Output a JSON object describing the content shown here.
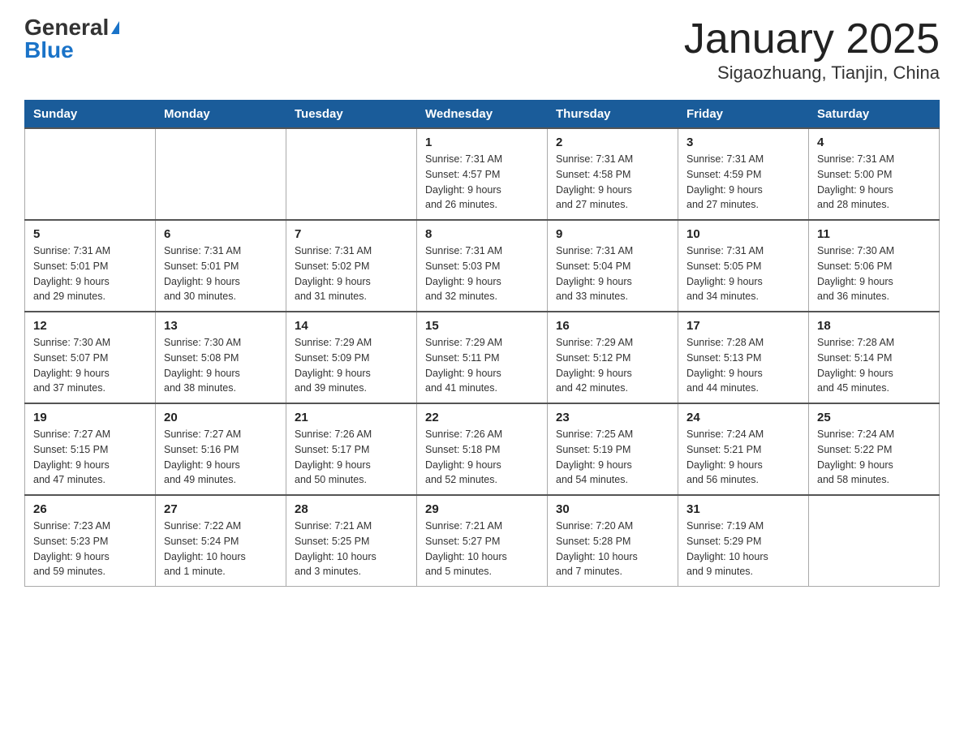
{
  "header": {
    "logo_general": "General",
    "logo_blue": "Blue",
    "month": "January 2025",
    "location": "Sigaozhuang, Tianjin, China"
  },
  "days_of_week": [
    "Sunday",
    "Monday",
    "Tuesday",
    "Wednesday",
    "Thursday",
    "Friday",
    "Saturday"
  ],
  "weeks": [
    [
      {
        "day": "",
        "info": ""
      },
      {
        "day": "",
        "info": ""
      },
      {
        "day": "",
        "info": ""
      },
      {
        "day": "1",
        "info": "Sunrise: 7:31 AM\nSunset: 4:57 PM\nDaylight: 9 hours\nand 26 minutes."
      },
      {
        "day": "2",
        "info": "Sunrise: 7:31 AM\nSunset: 4:58 PM\nDaylight: 9 hours\nand 27 minutes."
      },
      {
        "day": "3",
        "info": "Sunrise: 7:31 AM\nSunset: 4:59 PM\nDaylight: 9 hours\nand 27 minutes."
      },
      {
        "day": "4",
        "info": "Sunrise: 7:31 AM\nSunset: 5:00 PM\nDaylight: 9 hours\nand 28 minutes."
      }
    ],
    [
      {
        "day": "5",
        "info": "Sunrise: 7:31 AM\nSunset: 5:01 PM\nDaylight: 9 hours\nand 29 minutes."
      },
      {
        "day": "6",
        "info": "Sunrise: 7:31 AM\nSunset: 5:01 PM\nDaylight: 9 hours\nand 30 minutes."
      },
      {
        "day": "7",
        "info": "Sunrise: 7:31 AM\nSunset: 5:02 PM\nDaylight: 9 hours\nand 31 minutes."
      },
      {
        "day": "8",
        "info": "Sunrise: 7:31 AM\nSunset: 5:03 PM\nDaylight: 9 hours\nand 32 minutes."
      },
      {
        "day": "9",
        "info": "Sunrise: 7:31 AM\nSunset: 5:04 PM\nDaylight: 9 hours\nand 33 minutes."
      },
      {
        "day": "10",
        "info": "Sunrise: 7:31 AM\nSunset: 5:05 PM\nDaylight: 9 hours\nand 34 minutes."
      },
      {
        "day": "11",
        "info": "Sunrise: 7:30 AM\nSunset: 5:06 PM\nDaylight: 9 hours\nand 36 minutes."
      }
    ],
    [
      {
        "day": "12",
        "info": "Sunrise: 7:30 AM\nSunset: 5:07 PM\nDaylight: 9 hours\nand 37 minutes."
      },
      {
        "day": "13",
        "info": "Sunrise: 7:30 AM\nSunset: 5:08 PM\nDaylight: 9 hours\nand 38 minutes."
      },
      {
        "day": "14",
        "info": "Sunrise: 7:29 AM\nSunset: 5:09 PM\nDaylight: 9 hours\nand 39 minutes."
      },
      {
        "day": "15",
        "info": "Sunrise: 7:29 AM\nSunset: 5:11 PM\nDaylight: 9 hours\nand 41 minutes."
      },
      {
        "day": "16",
        "info": "Sunrise: 7:29 AM\nSunset: 5:12 PM\nDaylight: 9 hours\nand 42 minutes."
      },
      {
        "day": "17",
        "info": "Sunrise: 7:28 AM\nSunset: 5:13 PM\nDaylight: 9 hours\nand 44 minutes."
      },
      {
        "day": "18",
        "info": "Sunrise: 7:28 AM\nSunset: 5:14 PM\nDaylight: 9 hours\nand 45 minutes."
      }
    ],
    [
      {
        "day": "19",
        "info": "Sunrise: 7:27 AM\nSunset: 5:15 PM\nDaylight: 9 hours\nand 47 minutes."
      },
      {
        "day": "20",
        "info": "Sunrise: 7:27 AM\nSunset: 5:16 PM\nDaylight: 9 hours\nand 49 minutes."
      },
      {
        "day": "21",
        "info": "Sunrise: 7:26 AM\nSunset: 5:17 PM\nDaylight: 9 hours\nand 50 minutes."
      },
      {
        "day": "22",
        "info": "Sunrise: 7:26 AM\nSunset: 5:18 PM\nDaylight: 9 hours\nand 52 minutes."
      },
      {
        "day": "23",
        "info": "Sunrise: 7:25 AM\nSunset: 5:19 PM\nDaylight: 9 hours\nand 54 minutes."
      },
      {
        "day": "24",
        "info": "Sunrise: 7:24 AM\nSunset: 5:21 PM\nDaylight: 9 hours\nand 56 minutes."
      },
      {
        "day": "25",
        "info": "Sunrise: 7:24 AM\nSunset: 5:22 PM\nDaylight: 9 hours\nand 58 minutes."
      }
    ],
    [
      {
        "day": "26",
        "info": "Sunrise: 7:23 AM\nSunset: 5:23 PM\nDaylight: 9 hours\nand 59 minutes."
      },
      {
        "day": "27",
        "info": "Sunrise: 7:22 AM\nSunset: 5:24 PM\nDaylight: 10 hours\nand 1 minute."
      },
      {
        "day": "28",
        "info": "Sunrise: 7:21 AM\nSunset: 5:25 PM\nDaylight: 10 hours\nand 3 minutes."
      },
      {
        "day": "29",
        "info": "Sunrise: 7:21 AM\nSunset: 5:27 PM\nDaylight: 10 hours\nand 5 minutes."
      },
      {
        "day": "30",
        "info": "Sunrise: 7:20 AM\nSunset: 5:28 PM\nDaylight: 10 hours\nand 7 minutes."
      },
      {
        "day": "31",
        "info": "Sunrise: 7:19 AM\nSunset: 5:29 PM\nDaylight: 10 hours\nand 9 minutes."
      },
      {
        "day": "",
        "info": ""
      }
    ]
  ]
}
